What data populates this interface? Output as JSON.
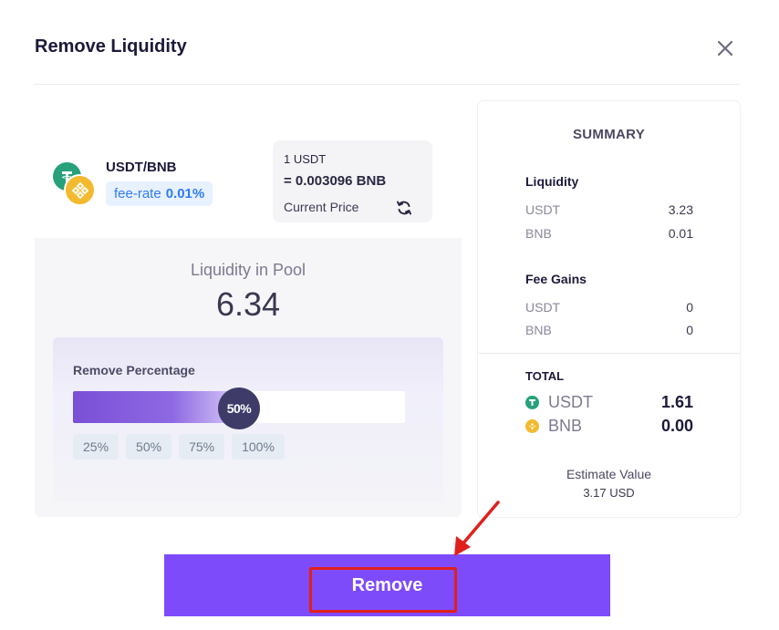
{
  "modal": {
    "title": "Remove Liquidity"
  },
  "pair": {
    "name": "USDT/BNB",
    "fee_label": "fee-rate",
    "fee_value": "0.01%",
    "token_a_icon": "usdt-icon",
    "token_b_icon": "bnb-icon"
  },
  "price": {
    "line1": "1 USDT",
    "line2": "= 0.003096 BNB",
    "label": "Current Price",
    "refresh_icon": "refresh-icon"
  },
  "pool": {
    "label": "Liquidity in Pool",
    "value": "6.34"
  },
  "removal": {
    "title": "Remove Percentage",
    "percent": 50,
    "percent_label": "50%",
    "presets": [
      "25%",
      "50%",
      "75%",
      "100%"
    ]
  },
  "summary": {
    "title": "SUMMARY",
    "liquidity": {
      "title": "Liquidity",
      "rows": [
        {
          "token": "USDT",
          "value": "3.23"
        },
        {
          "token": "BNB",
          "value": "0.01"
        }
      ]
    },
    "fee_gains": {
      "title": "Fee Gains",
      "rows": [
        {
          "token": "USDT",
          "value": "0"
        },
        {
          "token": "BNB",
          "value": "0"
        }
      ]
    },
    "total": {
      "title": "TOTAL",
      "rows": [
        {
          "token": "USDT",
          "value": "1.61"
        },
        {
          "token": "BNB",
          "value": "0.00"
        }
      ]
    },
    "estimate_label": "Estimate Value",
    "estimate_value": "3.17 USD"
  },
  "action": {
    "remove_label": "Remove"
  },
  "colors": {
    "accent": "#7e4bfa",
    "usdt": "#26a17b",
    "bnb": "#f3ba2f",
    "fee_text": "#2f7bf5",
    "annotation": "#e0201c"
  }
}
